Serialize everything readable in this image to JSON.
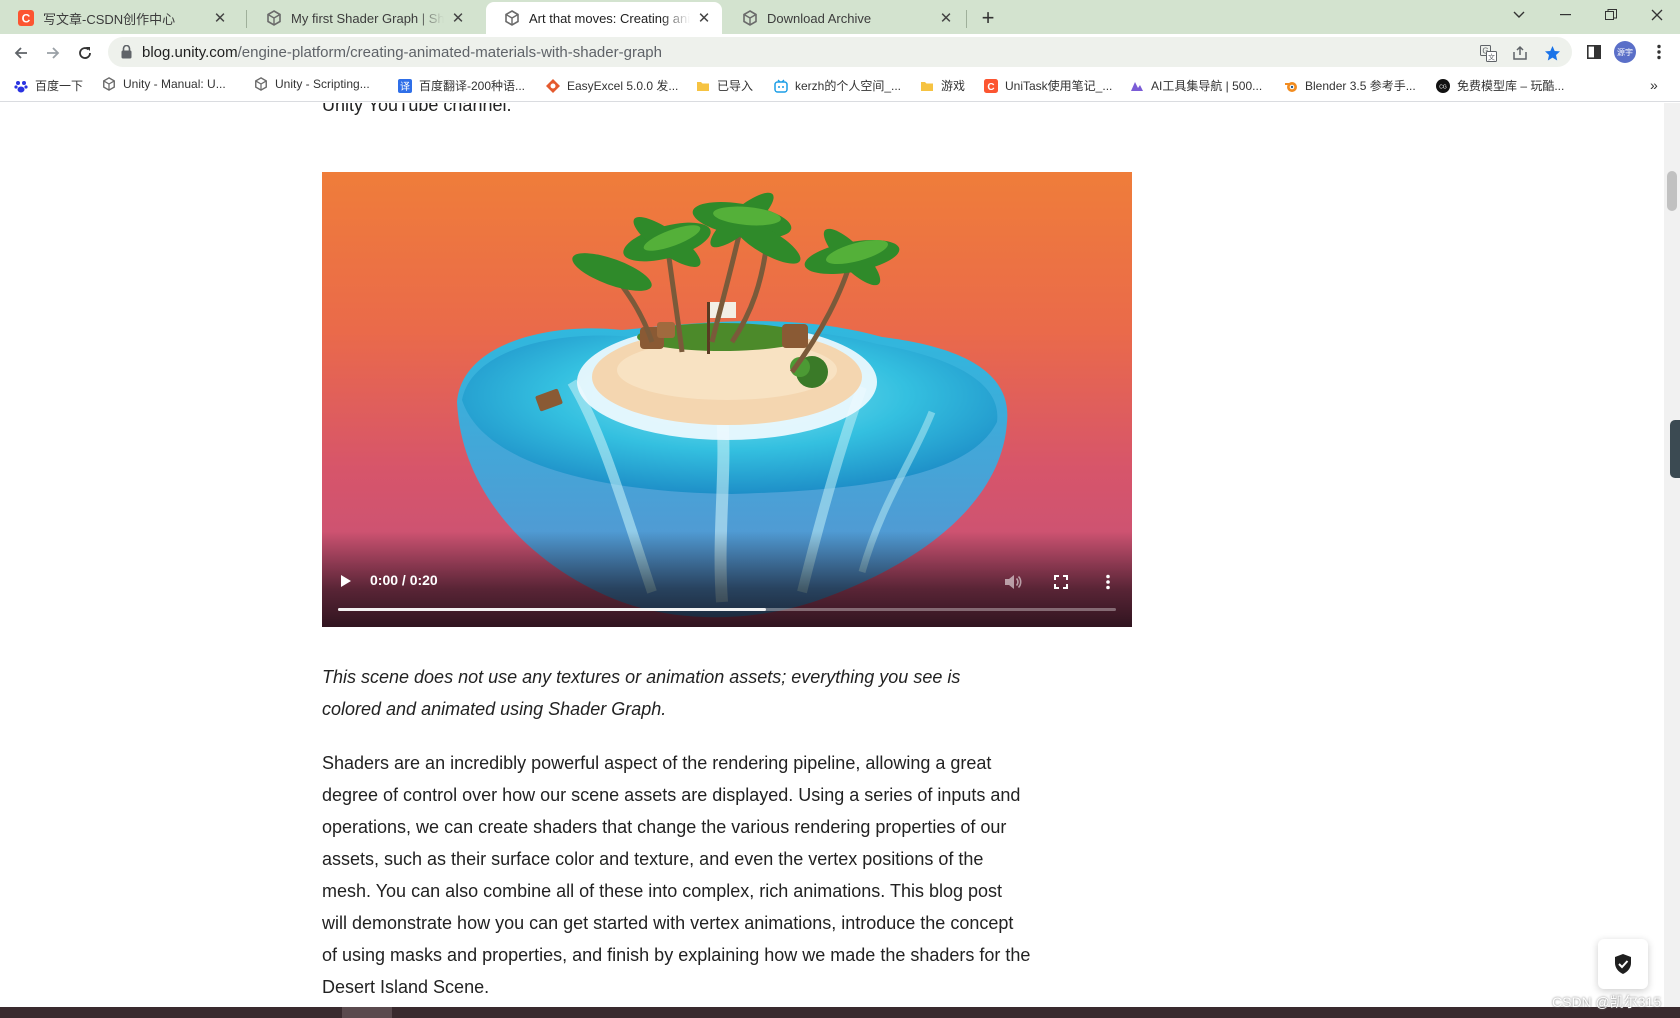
{
  "browser": {
    "tabs": [
      {
        "title": "写文章-CSDN创作中心",
        "favicon": "csdn-icon",
        "active": false
      },
      {
        "title": "My first Shader Graph | Shader",
        "favicon": "unity-icon",
        "active": false
      },
      {
        "title": "Art that moves: Creating anim",
        "favicon": "unity-icon",
        "active": true
      },
      {
        "title": "Download Archive",
        "favicon": "unity-icon",
        "active": false
      }
    ],
    "url_host": "blog.unity.com",
    "url_path": "/engine-platform/creating-animated-materials-with-shader-graph",
    "profile_label": "源宇",
    "bookmarks": [
      {
        "label": "百度一下",
        "icon": "baidu-icon"
      },
      {
        "label": "Unity - Manual: U...",
        "icon": "unity-icon"
      },
      {
        "label": "Unity - Scripting...",
        "icon": "unity-icon"
      },
      {
        "label": "百度翻译-200种语...",
        "icon": "translate-icon"
      },
      {
        "label": "EasyExcel 5.0.0 发...",
        "icon": "easyexcel-icon"
      },
      {
        "label": "已导入",
        "icon": "folder-icon"
      },
      {
        "label": "kerzh的个人空间_...",
        "icon": "bilibili-icon"
      },
      {
        "label": "游戏",
        "icon": "folder-icon"
      },
      {
        "label": "UniTask使用笔记_...",
        "icon": "csdn-icon"
      },
      {
        "label": "AI工具集导航 | 500...",
        "icon": "ai-icon"
      },
      {
        "label": "Blender 3.5 参考手...",
        "icon": "blender-icon"
      },
      {
        "label": "免费模型库 – 玩酷...",
        "icon": "cg-icon"
      }
    ]
  },
  "article": {
    "partial_top_line": "Unity YouTube channel.",
    "video": {
      "time": "0:00 / 0:20",
      "progress": 0.55
    },
    "caption": "This scene does not use any textures or animation assets; everything you see is colored and animated using Shader Graph.",
    "paragraph": "Shaders are an incredibly powerful aspect of the rendering pipeline, allowing a great degree of control over how our scene assets are displayed. Using a series of inputs and operations, we can create shaders that change the various rendering properties of our assets, such as their surface color and texture, and even the vertex positions of the mesh. You can also combine all of these into complex, rich animations. This blog post will demonstrate how you can get started with vertex animations, introduce the concept of using masks and properties, and finish by explaining how we made the shaders for the Desert Island Scene."
  },
  "overlay": {
    "watermark": "CSDN @凯尔315"
  },
  "colors": {
    "tabstrip": "#d3e3cf",
    "video_top": "#ef7d3a",
    "video_bottom": "#c1507c",
    "water": "#3cc3e0"
  }
}
